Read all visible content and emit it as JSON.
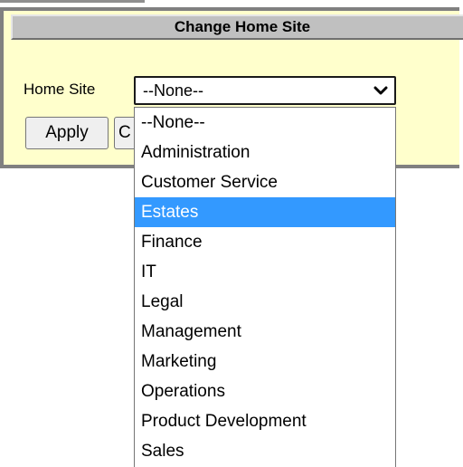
{
  "panel": {
    "title": "Change Home Site",
    "home_site_label": "Home Site",
    "selected_value": "--None--",
    "apply_label": "Apply",
    "second_button_label": "C"
  },
  "dropdown": {
    "options": [
      "--None--",
      "Administration",
      "Customer Service",
      "Estates",
      "Finance",
      "IT",
      "Legal",
      "Management",
      "Marketing",
      "Operations",
      "Product Development",
      "Sales"
    ],
    "highlighted_index": 3,
    "highlight_color": "#3399ff"
  },
  "colors": {
    "panel_bg": "#ffffcc",
    "header_bg": "#c0c0c0",
    "border": "#808080"
  }
}
